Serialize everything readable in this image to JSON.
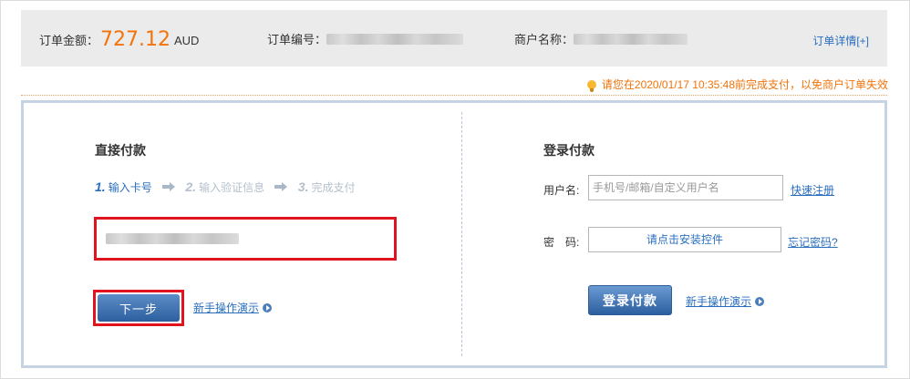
{
  "order": {
    "amount_label": "订单金额：",
    "amount": "727.12",
    "currency": "AUD",
    "number_label": "订单编号：",
    "merchant_label": "商户名称：",
    "detail_link": "订单详情[+]"
  },
  "notice": "请您在2020/01/17 10:35:48前完成支付，以免商户订单失效",
  "direct": {
    "title": "直接付款",
    "steps": [
      {
        "num": "1.",
        "label": "输入卡号"
      },
      {
        "num": "2.",
        "label": "输入验证信息"
      },
      {
        "num": "3.",
        "label": "完成支付"
      }
    ],
    "next_button": "下一步",
    "demo_link": "新手操作演示"
  },
  "login": {
    "title": "登录付款",
    "username_label": "用户名:",
    "username_placeholder": "手机号/邮箱/自定义用户名",
    "register_link": "快速注册",
    "password_label": "密　码:",
    "install_text": "请点击安装控件",
    "forgot_link": "忘记密码?",
    "login_button": "登录付款",
    "demo_link": "新手操作演示"
  },
  "colors": {
    "accent_orange": "#f2730a",
    "link_blue": "#2a6fbf",
    "highlight_red": "#e0141e"
  }
}
